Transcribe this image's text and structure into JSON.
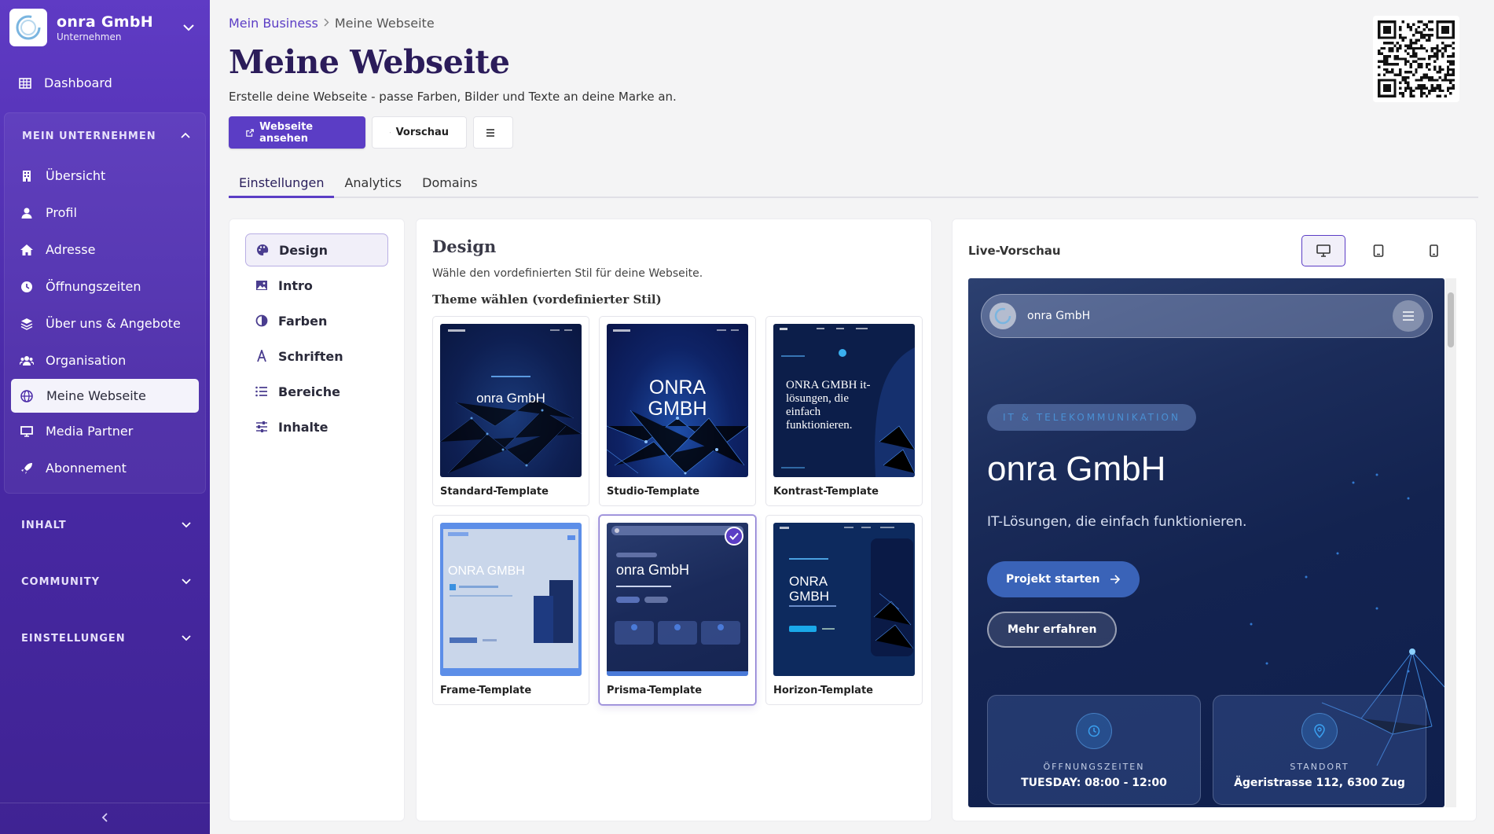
{
  "sidebar": {
    "brand_name": "onra GmbH",
    "brand_sub": "Unternehmen",
    "dashboard": "Dashboard",
    "group_title": "MEIN UNTERNEHMEN",
    "items": [
      {
        "label": "Übersicht"
      },
      {
        "label": "Profil"
      },
      {
        "label": "Adresse"
      },
      {
        "label": "Öffnungszeiten"
      },
      {
        "label": "Über uns & Angebote"
      },
      {
        "label": "Organisation"
      },
      {
        "label": "Meine Webseite"
      },
      {
        "label": "Media Partner"
      },
      {
        "label": "Abonnement"
      }
    ],
    "collapsed": [
      "INHALT",
      "COMMUNITY",
      "EINSTELLUNGEN"
    ]
  },
  "breadcrumb": {
    "parent": "Mein Business",
    "current": "Meine Webseite"
  },
  "page": {
    "title": "Meine Webseite",
    "subtitle": "Erstelle deine Webseite - passe Farben, Bilder und Texte an deine Marke an."
  },
  "actions": {
    "view": "Webseite ansehen",
    "preview": "Vorschau"
  },
  "tabs": [
    "Einstellungen",
    "Analytics",
    "Domains"
  ],
  "settings_menu": [
    "Design",
    "Intro",
    "Farben",
    "Schriften",
    "Bereiche",
    "Inhalte"
  ],
  "design": {
    "title": "Design",
    "desc": "Wähle den vordefinierten Stil für deine Webseite.",
    "theme_label": "Theme wählen (vordefinierter Stil)",
    "themes": [
      {
        "name": "Standard-Template",
        "thumb_text": "onra GmbH"
      },
      {
        "name": "Studio-Template",
        "thumb_text": "ONRA GMBH"
      },
      {
        "name": "Kontrast-Template",
        "thumb_text": "ONRA GMBH it-lösungen, die einfach funktionieren."
      },
      {
        "name": "Frame-Template",
        "thumb_text": "ONRA GMBH"
      },
      {
        "name": "Prisma-Template",
        "thumb_text": "onra GmbH"
      },
      {
        "name": "Horizon-Template",
        "thumb_text": "ONRA GMBH"
      }
    ],
    "selected": "Prisma-Template"
  },
  "preview": {
    "title": "Live-Vorschau",
    "brand": "onra GmbH",
    "badge": "IT & TELEKOMMUNIKATION",
    "hero": "onra GmbH",
    "lead": "IT-Lösungen, die einfach funktionieren.",
    "cta_primary": "Projekt starten",
    "cta_secondary": "Mehr erfahren",
    "info": [
      {
        "label": "ÖFFNUNGSZEITEN",
        "value": "TUESDAY: 08:00 - 12:00"
      },
      {
        "label": "STANDORT",
        "value": "Ägeristrasse 112, 6300 Zug"
      }
    ]
  },
  "colors": {
    "accent": "#5b3dc5",
    "sidebar": "#4a2aa8",
    "title": "#2b1c5a"
  }
}
